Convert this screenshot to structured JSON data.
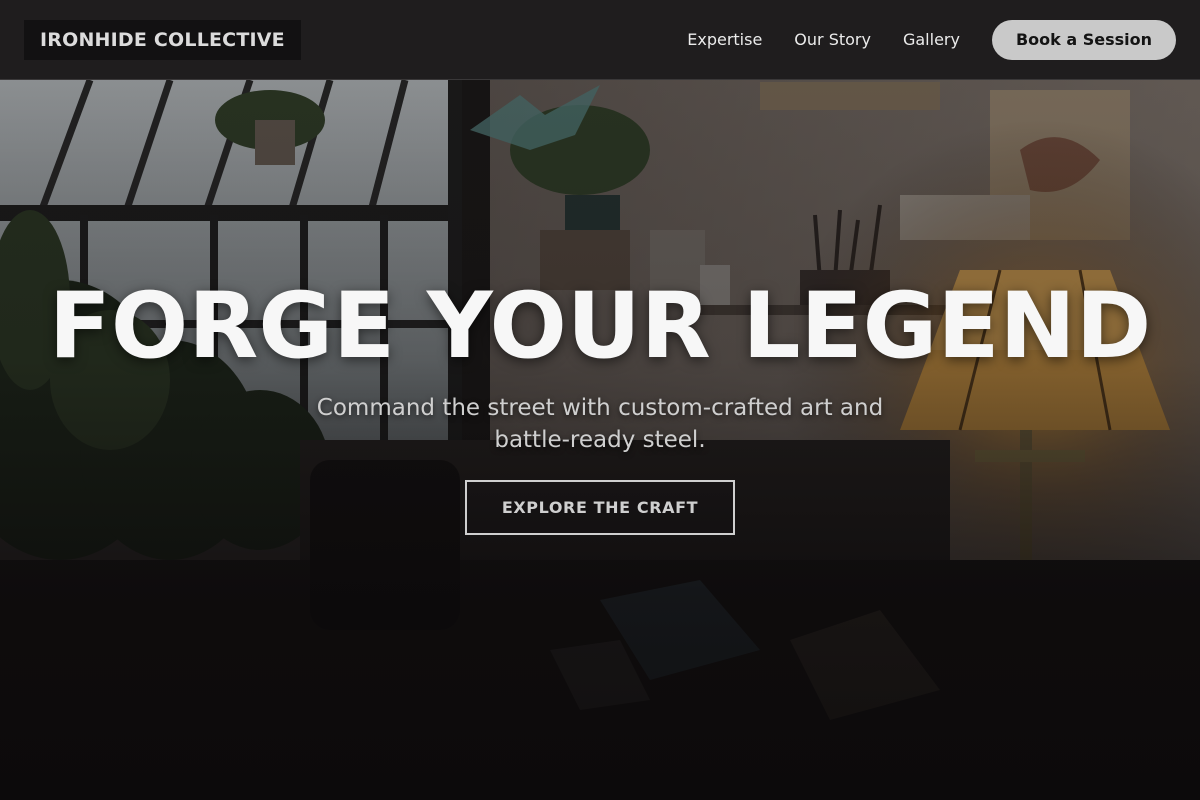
{
  "header": {
    "brand": "IRONHIDE COLLECTIVE",
    "nav": [
      {
        "label": "Expertise"
      },
      {
        "label": "Our Story"
      },
      {
        "label": "Gallery"
      }
    ],
    "cta_label": "Book a Session"
  },
  "hero": {
    "title": "FORGE YOUR LEGEND",
    "subtitle": "Command the street with custom-crafted art and battle-ready steel.",
    "button_label": "EXPLORE THE CRAFT",
    "background_image": "studio-interior-photo"
  },
  "colors": {
    "header_bg": "#1e1c1d",
    "brand_bg": "#121112",
    "cta_bg": "#c9c9c9",
    "title_text": "#f7f7f7",
    "subtitle_text": "#cfcfcf",
    "lamp_glow": "#c98a2a"
  }
}
